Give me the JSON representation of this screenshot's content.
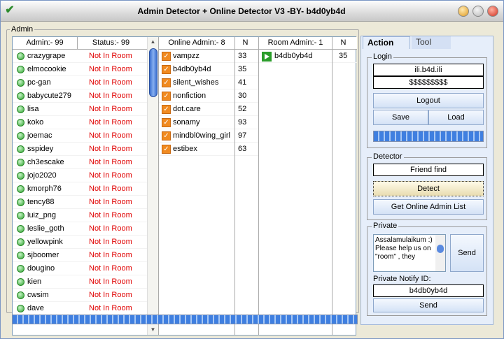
{
  "window": {
    "title": "Admin Detector + Online Detector V3 -BY- b4d0yb4d"
  },
  "admin_group": {
    "legend": "Admin",
    "col1_header": "Admin:- 99",
    "col2_header": "Status:- 99",
    "col3_header": "Online Admin:- 8",
    "col4_header": "N",
    "col5_header": "Room Admin:- 1",
    "col6_header": "N"
  },
  "admins": [
    {
      "name": "crazygrape",
      "status": "Not In Room"
    },
    {
      "name": "elmocookie",
      "status": "Not In Room"
    },
    {
      "name": "pc-gan",
      "status": "Not In Room"
    },
    {
      "name": "babycute279",
      "status": "Not In Room"
    },
    {
      "name": "lisa",
      "status": "Not In Room"
    },
    {
      "name": "koko",
      "status": "Not In Room"
    },
    {
      "name": "joemac",
      "status": "Not In Room"
    },
    {
      "name": "sspidey",
      "status": "Not In Room"
    },
    {
      "name": "ch3escake",
      "status": "Not In Room"
    },
    {
      "name": "jojo2020",
      "status": "Not In Room"
    },
    {
      "name": "kmorph76",
      "status": "Not In Room"
    },
    {
      "name": "tency88",
      "status": "Not In Room"
    },
    {
      "name": "luiz_png",
      "status": "Not In Room"
    },
    {
      "name": "leslie_goth",
      "status": "Not In Room"
    },
    {
      "name": "yellowpink",
      "status": "Not In Room"
    },
    {
      "name": "sjboomer",
      "status": "Not In Room"
    },
    {
      "name": "dougino",
      "status": "Not In Room"
    },
    {
      "name": "kien",
      "status": "Not In Room"
    },
    {
      "name": "cwsim",
      "status": "Not In Room"
    },
    {
      "name": "dave",
      "status": "Not In Room"
    }
  ],
  "online_admins": [
    {
      "name": "vampzz",
      "n": "33"
    },
    {
      "name": "b4db0yb4d",
      "n": "35"
    },
    {
      "name": "silent_wishes",
      "n": "41"
    },
    {
      "name": "nonfiction",
      "n": "30"
    },
    {
      "name": "dot.care",
      "n": "52"
    },
    {
      "name": "sonamy",
      "n": "93"
    },
    {
      "name": "mindbl0wing_girl",
      "n": "97"
    },
    {
      "name": "estibex",
      "n": "63"
    }
  ],
  "room_admins": [
    {
      "name": "b4db0yb4d",
      "n": "35"
    }
  ],
  "side": {
    "tab_action": "Action",
    "tab_tool": "Tool",
    "login_label": "Login",
    "login_user": "ili.b4d.ili",
    "login_pass": "$$$$$$$$$",
    "logout_label": "Logout",
    "save_label": "Save",
    "load_label": "Load",
    "detector_label": "Detector",
    "friend_find": "Friend find",
    "detect_label": "Detect",
    "get_online_label": "Get Online Admin List",
    "private_label": "Private",
    "private_message": "Assalamulaikum :) Please help us on \"room\" , they",
    "send_label": "Send",
    "notify_label": "Private Notify ID:",
    "notify_id": "b4db0yb4d",
    "send2_label": "Send"
  }
}
